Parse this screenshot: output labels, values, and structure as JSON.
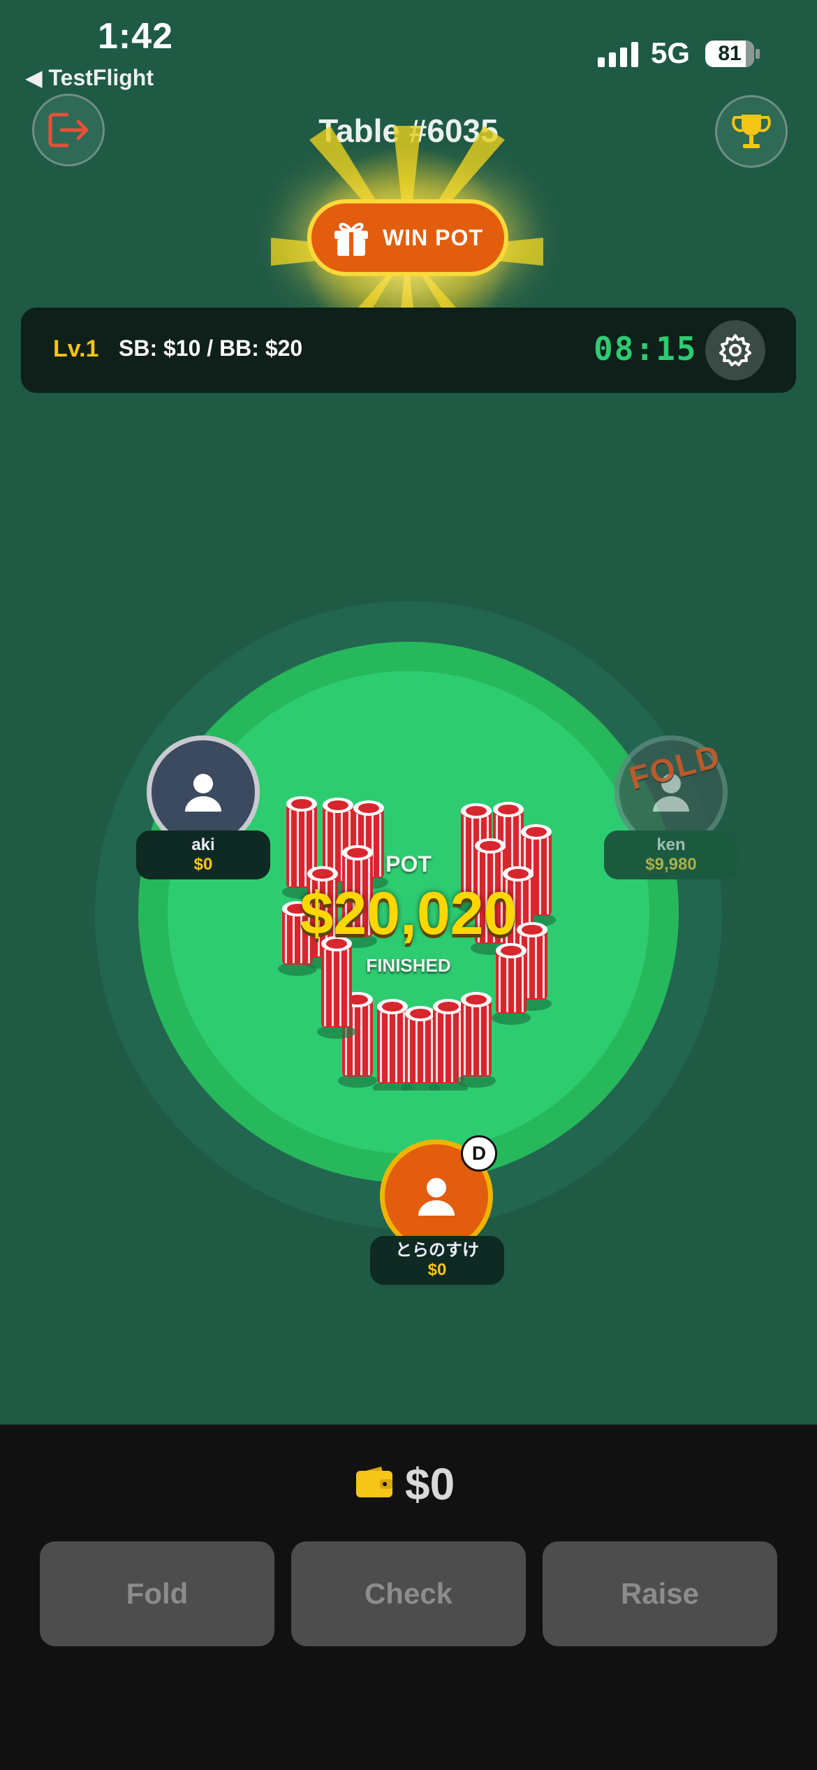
{
  "status_bar": {
    "time": "1:42",
    "back_app": "◀ TestFlight",
    "network": "5G",
    "battery": "81"
  },
  "header": {
    "table_title": "Table #6035",
    "win_pot_label": "WIN POT"
  },
  "info_bar": {
    "level": "Lv.1",
    "blinds": "SB: $10 / BB: $20",
    "timer": "08:15"
  },
  "pot": {
    "label": "POT",
    "amount": "$20,020",
    "status": "FINISHED"
  },
  "players": [
    {
      "name": "aki",
      "chips": "$0",
      "state": ""
    },
    {
      "name": "ken",
      "chips": "$9,980",
      "state": "FOLD"
    },
    {
      "name": "とらのすけ",
      "chips": "$0",
      "dealer": "D"
    }
  ],
  "wallet": {
    "balance": "$0"
  },
  "actions": {
    "fold": "Fold",
    "check": "Check",
    "raise": "Raise"
  },
  "colors": {
    "background": "#1f5a45",
    "table": "#2ecc71",
    "accent_orange": "#e25d0e",
    "gold": "#f5c518",
    "timer_green": "#2ecc71",
    "chip_red": "#d8262f"
  }
}
